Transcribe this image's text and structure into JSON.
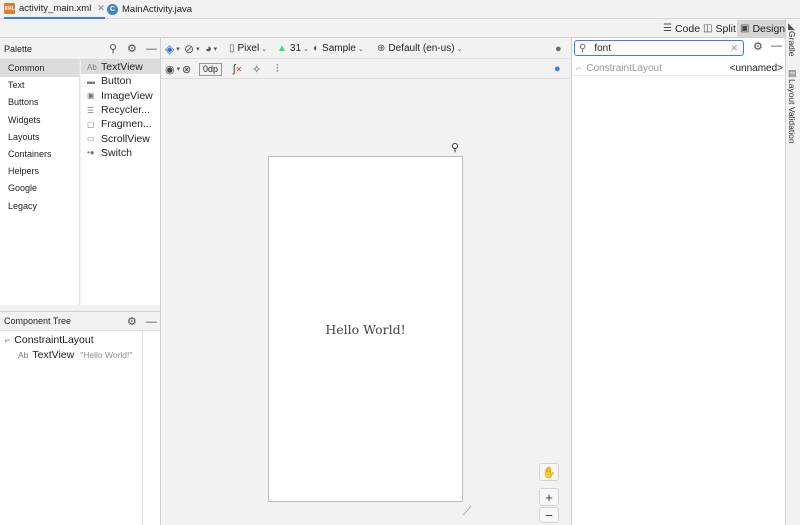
{
  "tabs": [
    {
      "label": "activity_main.xml",
      "icon": "xml-file-icon",
      "active": true
    },
    {
      "label": "MainActivity.java",
      "icon": "java-class-icon",
      "active": false
    }
  ],
  "icon_text": {
    "xml": "XML",
    "java": "C"
  },
  "view_modes": {
    "code": "Code",
    "split": "Split",
    "design": "Design"
  },
  "palette": {
    "title": "Palette",
    "categories": [
      "Common",
      "Text",
      "Buttons",
      "Widgets",
      "Layouts",
      "Containers",
      "Helpers",
      "Google",
      "Legacy"
    ],
    "selected_category": "Common",
    "items": [
      {
        "label": "TextView",
        "glyph": "Ab"
      },
      {
        "label": "Button",
        "glyph": "▬"
      },
      {
        "label": "ImageView",
        "glyph": "▣"
      },
      {
        "label": "Recycler...",
        "glyph": "☰"
      },
      {
        "label": "Fragmen...",
        "glyph": "▢"
      },
      {
        "label": "ScrollView",
        "glyph": "▭"
      },
      {
        "label": "Switch",
        "glyph": "•●"
      }
    ]
  },
  "component_tree": {
    "title": "Component Tree",
    "root": "ConstraintLayout",
    "child": {
      "glyph": "Ab",
      "label": "TextView",
      "sub": "\"Hello World!\""
    }
  },
  "toolbar": {
    "device": "Pixel",
    "api": "31",
    "theme": "Sample",
    "locale": "Default (en-us)",
    "margin": "0dp"
  },
  "canvas": {
    "hello_text": "Hello World!",
    "zoom_in": "+",
    "zoom_out": "−"
  },
  "attributes": {
    "search_value": "font",
    "layout_label": "ConstraintLayout",
    "id_value": "<unnamed>"
  },
  "side_tools": {
    "gradle": "Gradle",
    "validation": "Layout Validation"
  },
  "colors": {
    "accent": "#3d7cf0",
    "selection": "#dcdcdc",
    "api_green": "#3ddc84"
  }
}
